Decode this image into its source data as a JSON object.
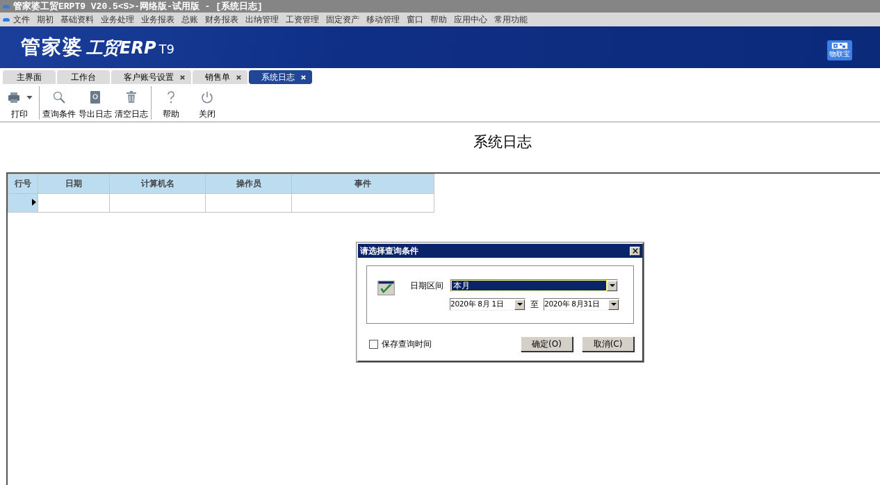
{
  "window": {
    "title": "管家婆工贸ERPT9 V20.5<S>-网络版-试用版 - [系统日志]"
  },
  "menu": [
    "文件",
    "期初",
    "基础资料",
    "业务处理",
    "业务报表",
    "总账",
    "财务报表",
    "出纳管理",
    "工资管理",
    "固定资产",
    "移动管理",
    "窗口",
    "帮助",
    "应用中心",
    "常用功能"
  ],
  "banner": {
    "logo": "管家婆",
    "logo_sub": "工贸ERP",
    "logo_ver": "T9",
    "badge": "物联宝"
  },
  "tabs": [
    {
      "label": "主界面",
      "selected": false,
      "closable": false
    },
    {
      "label": "工作台",
      "selected": false,
      "closable": false
    },
    {
      "label": "客户账号设置",
      "selected": false,
      "closable": true
    },
    {
      "label": "销售单",
      "selected": false,
      "closable": true
    },
    {
      "label": "系统日志",
      "selected": true,
      "closable": true
    }
  ],
  "toolbar": [
    {
      "kind": "print",
      "label": "打印"
    },
    {
      "kind": "search",
      "label": "查询条件"
    },
    {
      "kind": "export",
      "label": "导出日志"
    },
    {
      "kind": "trash",
      "label": "清空日志"
    },
    {
      "kind": "help",
      "label": "帮助"
    },
    {
      "kind": "power",
      "label": "关闭"
    }
  ],
  "page_title": "系统日志",
  "table": {
    "columns": [
      "行号",
      "日期",
      "计算机名",
      "操作员",
      "事件"
    ]
  },
  "dialog": {
    "title": "请选择查询条件",
    "date_range_label": "日期区间",
    "date_range": "本月",
    "from": "2020年 8月 1日",
    "to_label": "至",
    "to": "2020年 8月31日",
    "save_label": "保存查询时间",
    "save_checked": false,
    "ok": "确定(O)",
    "cancel": "取消(C)"
  }
}
